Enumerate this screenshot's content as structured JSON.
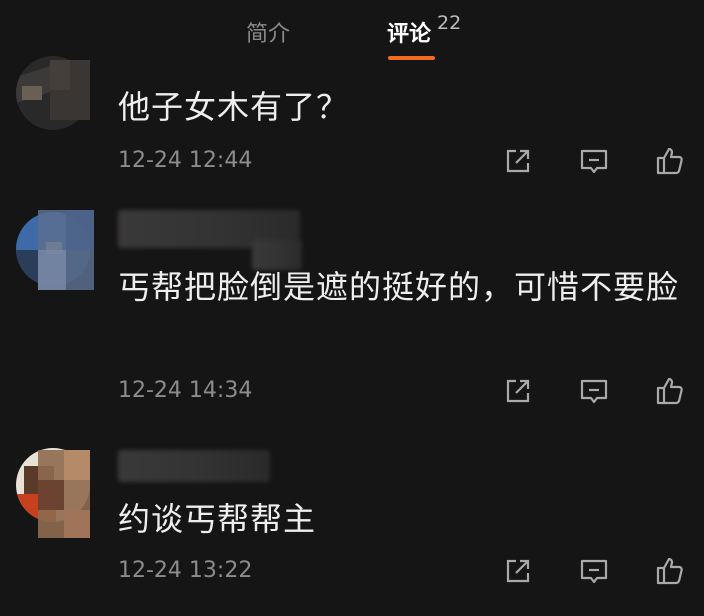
{
  "tabs": {
    "intro_label": "简介",
    "comments_label": "评论",
    "comments_count": "22"
  },
  "accent_color": "#f26a1b",
  "comments": [
    {
      "text": "他子女木有了？",
      "time": "12-24 12:44"
    },
    {
      "text": "丐帮把脸倒是遮的挺好的，可惜不要脸",
      "time": "12-24 14:34"
    },
    {
      "text": "约谈丐帮帮主",
      "time": "12-24 13:22"
    }
  ],
  "action_icons": [
    "share-icon",
    "reply-icon",
    "like-icon"
  ]
}
